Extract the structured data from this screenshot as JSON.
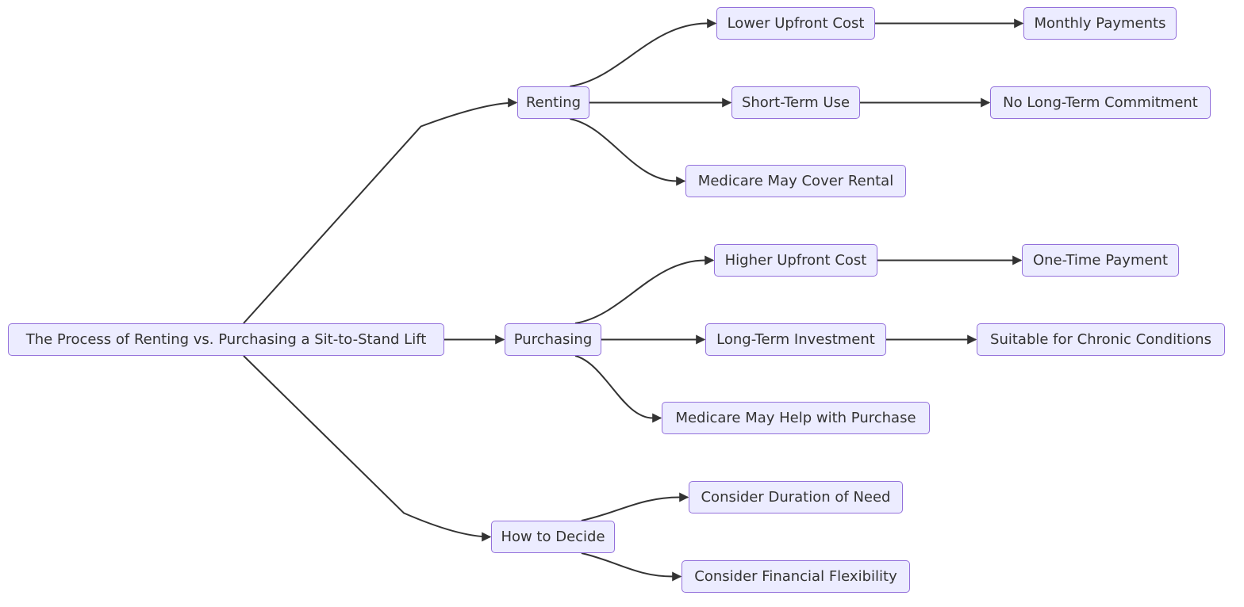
{
  "diagram": {
    "type": "flowchart",
    "direction": "left-to-right",
    "colors": {
      "node_fill": "#ECECFF",
      "node_border": "#9370DB",
      "text": "#333333",
      "edge": "#333333"
    },
    "nodes": {
      "root": "The Process of Renting vs. Purchasing a Sit-to-Stand Lift",
      "renting": "Renting",
      "purchasing": "Purchasing",
      "decide": "How to Decide",
      "lower_cost": "Lower Upfront Cost",
      "short_term": "Short-Term Use",
      "medicare_rental": "Medicare May Cover Rental",
      "higher_cost": "Higher Upfront Cost",
      "long_term": "Long-Term Investment",
      "medicare_purchase": "Medicare May Help with Purchase",
      "duration": "Consider Duration of Need",
      "financial": "Consider Financial Flexibility",
      "monthly": "Monthly Payments",
      "no_commitment": "No Long-Term Commitment",
      "one_time": "One-Time Payment",
      "chronic": "Suitable for Chronic Conditions"
    },
    "edges": [
      [
        "root",
        "renting"
      ],
      [
        "root",
        "purchasing"
      ],
      [
        "root",
        "decide"
      ],
      [
        "renting",
        "lower_cost"
      ],
      [
        "renting",
        "short_term"
      ],
      [
        "renting",
        "medicare_rental"
      ],
      [
        "purchasing",
        "higher_cost"
      ],
      [
        "purchasing",
        "long_term"
      ],
      [
        "purchasing",
        "medicare_purchase"
      ],
      [
        "decide",
        "duration"
      ],
      [
        "decide",
        "financial"
      ],
      [
        "lower_cost",
        "monthly"
      ],
      [
        "short_term",
        "no_commitment"
      ],
      [
        "higher_cost",
        "one_time"
      ],
      [
        "long_term",
        "chronic"
      ]
    ]
  }
}
